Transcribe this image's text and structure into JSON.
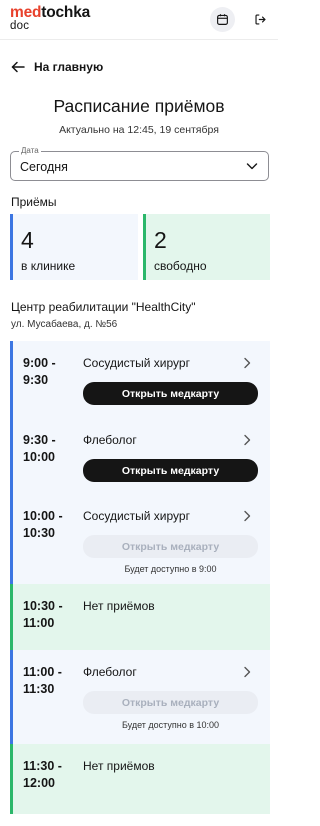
{
  "header": {
    "logo_med": "med",
    "logo_tochka": "tochka",
    "logo_doc": "doc",
    "calendar_icon": "calendar-icon",
    "logout_icon": "logout-icon"
  },
  "nav": {
    "back_label": "На главную",
    "back_icon": "arrow-left-icon"
  },
  "page": {
    "title": "Расписание приёмов",
    "subtitle": "Актуально на 12:45, 19 сентября"
  },
  "date_select": {
    "label": "Дата",
    "value": "Сегодня",
    "icon": "chevron-down-icon"
  },
  "appointments": {
    "label": "Приёмы",
    "in_clinic": {
      "count": "4",
      "text": "в клинике"
    },
    "free": {
      "count": "2",
      "text": "свободно"
    }
  },
  "clinic": {
    "name": "Центр реабилитации \"HealthCity\"",
    "address": "ул. Мусабаева, д. №56"
  },
  "colors": {
    "accent_red": "#e8412c",
    "busy_border": "#3c76e2",
    "busy_bg": "#f3f7fd",
    "free_border": "#2bb76a",
    "free_bg": "#e3f6ec"
  },
  "slots": [
    {
      "time_start": "9:00 -",
      "time_end": "9:30",
      "doctor": "Сосудистый хирург",
      "button": "Открыть медкарту",
      "note": ""
    },
    {
      "time_start": "9:30 -",
      "time_end": "10:00",
      "doctor": "Флеболог",
      "button": "Открыть медкарту",
      "note": ""
    },
    {
      "time_start": "10:00 -",
      "time_end": "10:30",
      "doctor": "Сосудистый хирург",
      "button": "Открыть медкарту",
      "note": "Будет доступно в 9:00"
    },
    {
      "time_start": "10:30 -",
      "time_end": "11:00",
      "doctor": "Нет приёмов"
    },
    {
      "time_start": "11:00 -",
      "time_end": "11:30",
      "doctor": "Флеболог",
      "button": "Открыть медкарту",
      "note": "Будет доступно в 10:00"
    },
    {
      "time_start": "11:30 -",
      "time_end": "12:00",
      "doctor": "Нет приёмов"
    }
  ]
}
